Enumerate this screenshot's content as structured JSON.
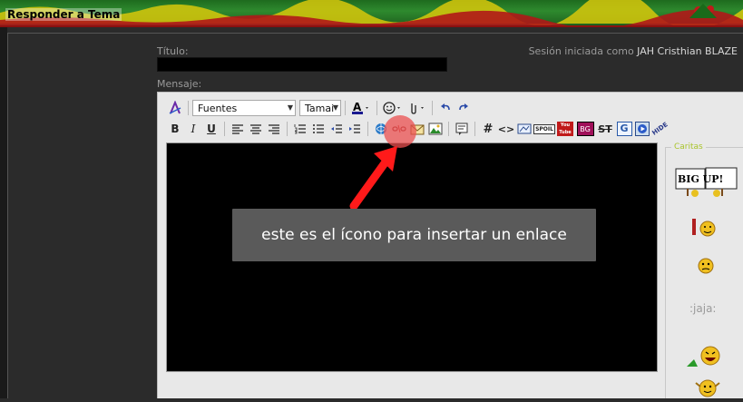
{
  "header": {
    "title": "Responder a Tema"
  },
  "form": {
    "title_label": "Título:",
    "message_label": "Mensaje:",
    "session_prefix": "Sesión iniciada como",
    "username": "JAH Cristhian BLAZE"
  },
  "toolbar": {
    "font_select": "Fuentes",
    "size_select": "Tamai",
    "buttons_row1": [
      "format-icon",
      "font-color-icon",
      "smiley-icon",
      "attachment-icon",
      "undo-icon",
      "redo-icon"
    ],
    "buttons_row2_text": {
      "bold": "B",
      "italic": "I",
      "underline": "U",
      "hash": "#",
      "code": "<>",
      "spoil": "SPOIL",
      "youtube": "You Tube",
      "bg": "BG",
      "strike": "ST",
      "google": "G",
      "hide": "HIDE"
    }
  },
  "smilies": {
    "legend": "Caritas",
    "bigup": "BIG UP!",
    "jaja": ":jaja:"
  },
  "annotation": {
    "text": "este es el ícono para insertar un enlace"
  },
  "colors": {
    "header_green": "#2e8a2e",
    "page_bg": "#2b2b2b",
    "editor_bg": "#e8e8e8",
    "tooltip_bg": "#5a5a5a",
    "highlight": "#eb5050",
    "arrow": "#ff1a1a"
  }
}
